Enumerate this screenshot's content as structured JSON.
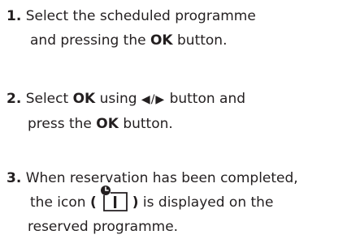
{
  "steps": [
    {
      "number": "1.",
      "line1": "Select the scheduled programme",
      "line2_a": "and pressing the ",
      "line2_bold": "OK",
      "line2_b": " button."
    },
    {
      "number": "2.",
      "line1_a": "Select ",
      "line1_bold": "OK",
      "line1_b": " using ",
      "arrows": "◀/▶",
      "line1_c": " button and",
      "line2_a": "press the ",
      "line2_bold": "OK",
      "line2_b": " button."
    },
    {
      "number": "3.",
      "line1": "When reservation has been completed,",
      "line2_a": "the icon ",
      "paren_open": "(",
      "icon_name": "reservation-timer-icon",
      "paren_close": ")",
      "line2_b": " is displayed on the",
      "line3": "reserved programme."
    }
  ]
}
